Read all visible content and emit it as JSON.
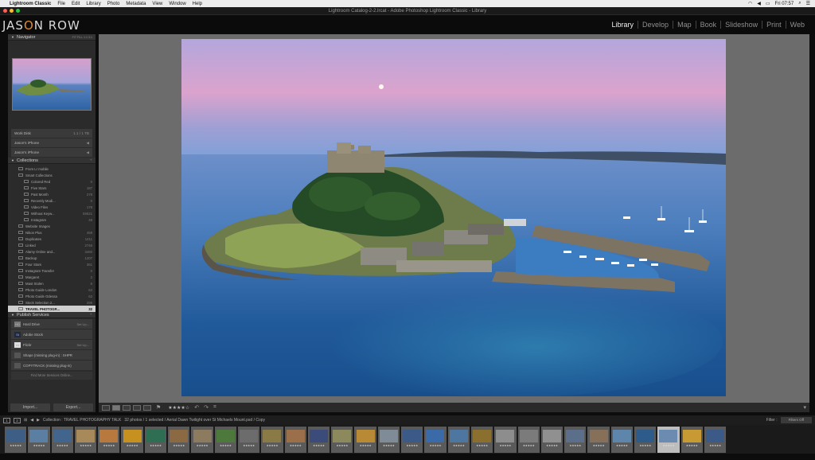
{
  "menubar": {
    "app_name": "Lightroom Classic",
    "items": [
      "File",
      "Edit",
      "Library",
      "Photo",
      "Metadata",
      "View",
      "Window",
      "Help"
    ],
    "clock": "Fri 07:57"
  },
  "window": {
    "title": "Lightroom Catalog-2-2.lrcat - Adobe Photoshop Lightroom Classic - Library"
  },
  "identity": {
    "logo_pre": "JAS",
    "logo_o": "O",
    "logo_post": "N ROW"
  },
  "modules": [
    "Library",
    "Develop",
    "Map",
    "Book",
    "Slideshow",
    "Print",
    "Web"
  ],
  "active_module": "Library",
  "navigator": {
    "title": "Navigator",
    "zoom_options": "FIT  FILL  1:1  3:1"
  },
  "drives": [
    {
      "label": "Work Disk",
      "count": "1.1 / 1 TB"
    },
    {
      "label": "Jason's iPhone",
      "count": ""
    },
    {
      "label": "Jason's iPhone",
      "count": ""
    }
  ],
  "collections_header": "Collections",
  "collections": [
    {
      "label": "From Lr mobile",
      "count": "",
      "indent": 1
    },
    {
      "label": "Smart Collections",
      "count": "",
      "indent": 1
    },
    {
      "label": "Colored Red",
      "count": "0",
      "indent": 2
    },
    {
      "label": "Five Stars",
      "count": "187",
      "indent": 2
    },
    {
      "label": "Past Month",
      "count": "278",
      "indent": 2
    },
    {
      "label": "Recently Modi...",
      "count": "0",
      "indent": 2
    },
    {
      "label": "Video Files",
      "count": "178",
      "indent": 2
    },
    {
      "label": "Without Keyw...",
      "count": "59521",
      "indent": 2
    },
    {
      "label": "Instagram",
      "count": "48",
      "indent": 2
    },
    {
      "label": "Website Images",
      "count": "",
      "indent": 1
    },
    {
      "label": "Nikon Plus",
      "count": "459",
      "indent": 1
    },
    {
      "label": "Duplicates",
      "count": "1411",
      "indent": 1
    },
    {
      "label": "Linked",
      "count": "2746",
      "indent": 1
    },
    {
      "label": "Alamy Online and...",
      "count": "3460",
      "indent": 1
    },
    {
      "label": "Backup",
      "count": "1207",
      "indent": 1
    },
    {
      "label": "Four Stars",
      "count": "361",
      "indent": 1
    },
    {
      "label": "Instagram Transfer",
      "count": "0",
      "indent": 1
    },
    {
      "label": "Margaret",
      "count": "2",
      "indent": 1
    },
    {
      "label": "Mast Stolen",
      "count": "6",
      "indent": 1
    },
    {
      "label": "Photo Guide London",
      "count": "63",
      "indent": 1
    },
    {
      "label": "Photo Guide Odessa",
      "count": "62",
      "indent": 1
    },
    {
      "label": "Stock Selection 2...",
      "count": "295",
      "indent": 1
    },
    {
      "label": "TRAVEL PHOTOGR...",
      "count": "32",
      "indent": 1,
      "selected": true
    }
  ],
  "publish": {
    "title": "Publish Services",
    "services": [
      {
        "label": "Hard Drive",
        "action": "Set Up...",
        "badge": "HD",
        "color": "#777"
      },
      {
        "label": "Adobe Stock",
        "action": "",
        "badge": "St",
        "color": "#1e2a44"
      },
      {
        "label": "Flickr",
        "action": "Set Up...",
        "badge": "●●",
        "color": "#ddd"
      },
      {
        "label": "Shape (missing plug-in) : SHPR",
        "action": "",
        "badge": "",
        "color": "#555"
      },
      {
        "label": "COPYTRACK (missing plug-in)",
        "action": "",
        "badge": "",
        "color": "#555"
      }
    ],
    "find_more": "Find More Services Online..."
  },
  "buttons": {
    "import": "Import...",
    "export": "Export..."
  },
  "toolbar": {
    "stars": "★★★★☆"
  },
  "filmstrip_bar": {
    "page1": "1",
    "page2": "2",
    "source": "Collection : TRAVEL PHOTOGRAPHY TALK",
    "info": "32 photos / 1 selected / Aerial Dawn Twilight over St Michaels Mount.psd / Copy",
    "filter_label": "Filter :",
    "filter_value": "Filters Off"
  },
  "filmstrip": {
    "stars": "★★★★★",
    "selected_index": 28,
    "thumb_colors": [
      "#3d5f86",
      "#5a7fa3",
      "#42658e",
      "#a8895a",
      "#b7793e",
      "#c6911f",
      "#2e6e52",
      "#8b6a43",
      "#8c7b5f",
      "#4d7a3c",
      "#6c6c6c",
      "#8a7a46",
      "#9a6f4a",
      "#3c4c7a",
      "#8c8a5c",
      "#b98a36",
      "#7f8c97",
      "#3b5a88",
      "#3a6aa8",
      "#4d76a0",
      "#8a6f2f",
      "#8d8d8d",
      "#7b7b7b",
      "#909090",
      "#5b6f8a",
      "#87705a",
      "#5d86aa",
      "#2e5c8a",
      "#6c8bb0",
      "#c79a34",
      "#3b5a88"
    ]
  }
}
